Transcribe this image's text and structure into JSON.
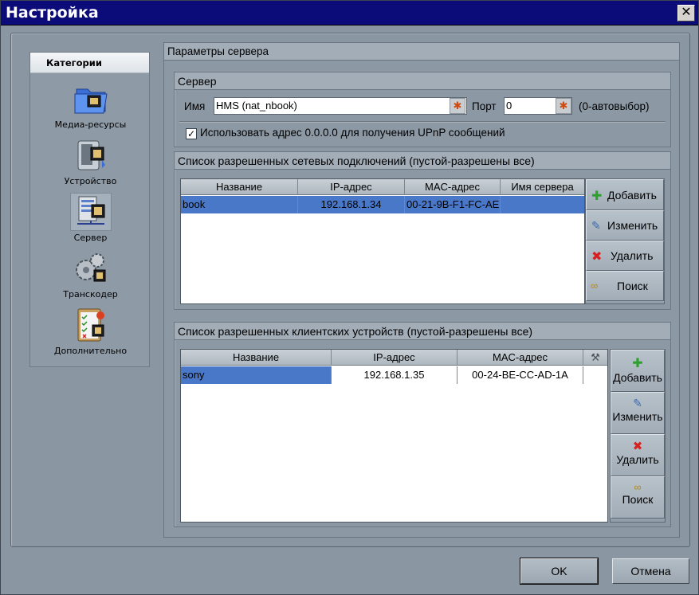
{
  "window": {
    "title": "Настройка"
  },
  "categories": {
    "header": "Категории",
    "items": [
      {
        "label": "Медиа-ресурсы",
        "icon": "media-folder-icon"
      },
      {
        "label": "Устройство",
        "icon": "device-icon"
      },
      {
        "label": "Сервер",
        "icon": "server-icon",
        "selected": true
      },
      {
        "label": "Транскодер",
        "icon": "transcoder-gear-icon"
      },
      {
        "label": "Дополнительно",
        "icon": "clipboard-checklist-icon"
      }
    ]
  },
  "main": {
    "title": "Параметры сервера"
  },
  "server_group": {
    "title": "Сервер",
    "name_label": "Имя",
    "name_value": "HMS (nat_nbook)",
    "port_label": "Порт",
    "port_value": "0",
    "port_hint": "(0-автовыбор)",
    "upnp_checked": true,
    "upnp_label": "Использовать адрес 0.0.0.0 для получения UPnP сообщений"
  },
  "connections_group": {
    "title": "Список разрешенных сетевых подключений (пустой-разрешены все)",
    "columns": [
      "Название",
      "IP-адрес",
      "MAC-адрес",
      "Имя сервера"
    ],
    "rows": [
      {
        "name": "book",
        "ip": "192.168.1.34",
        "mac": "00-21-9B-F1-FC-AE",
        "server": ""
      }
    ],
    "buttons": {
      "add": "Добавить",
      "edit": "Изменить",
      "delete": "Удалить",
      "search": "Поиск"
    }
  },
  "devices_group": {
    "title": "Список разрешенных клиентских устройств (пустой-разрешены все)",
    "columns": [
      "Название",
      "IP-адрес",
      "MAC-адрес"
    ],
    "settings_column_icon": "tools-icon",
    "rows": [
      {
        "name": "sony",
        "ip": "192.168.1.35",
        "mac": "00-24-BE-CC-AD-1A"
      }
    ],
    "buttons": {
      "add": "Добавить",
      "edit": "Изменить",
      "delete": "Удалить",
      "search": "Поиск"
    }
  },
  "footer": {
    "ok": "OK",
    "cancel": "Отмена"
  }
}
